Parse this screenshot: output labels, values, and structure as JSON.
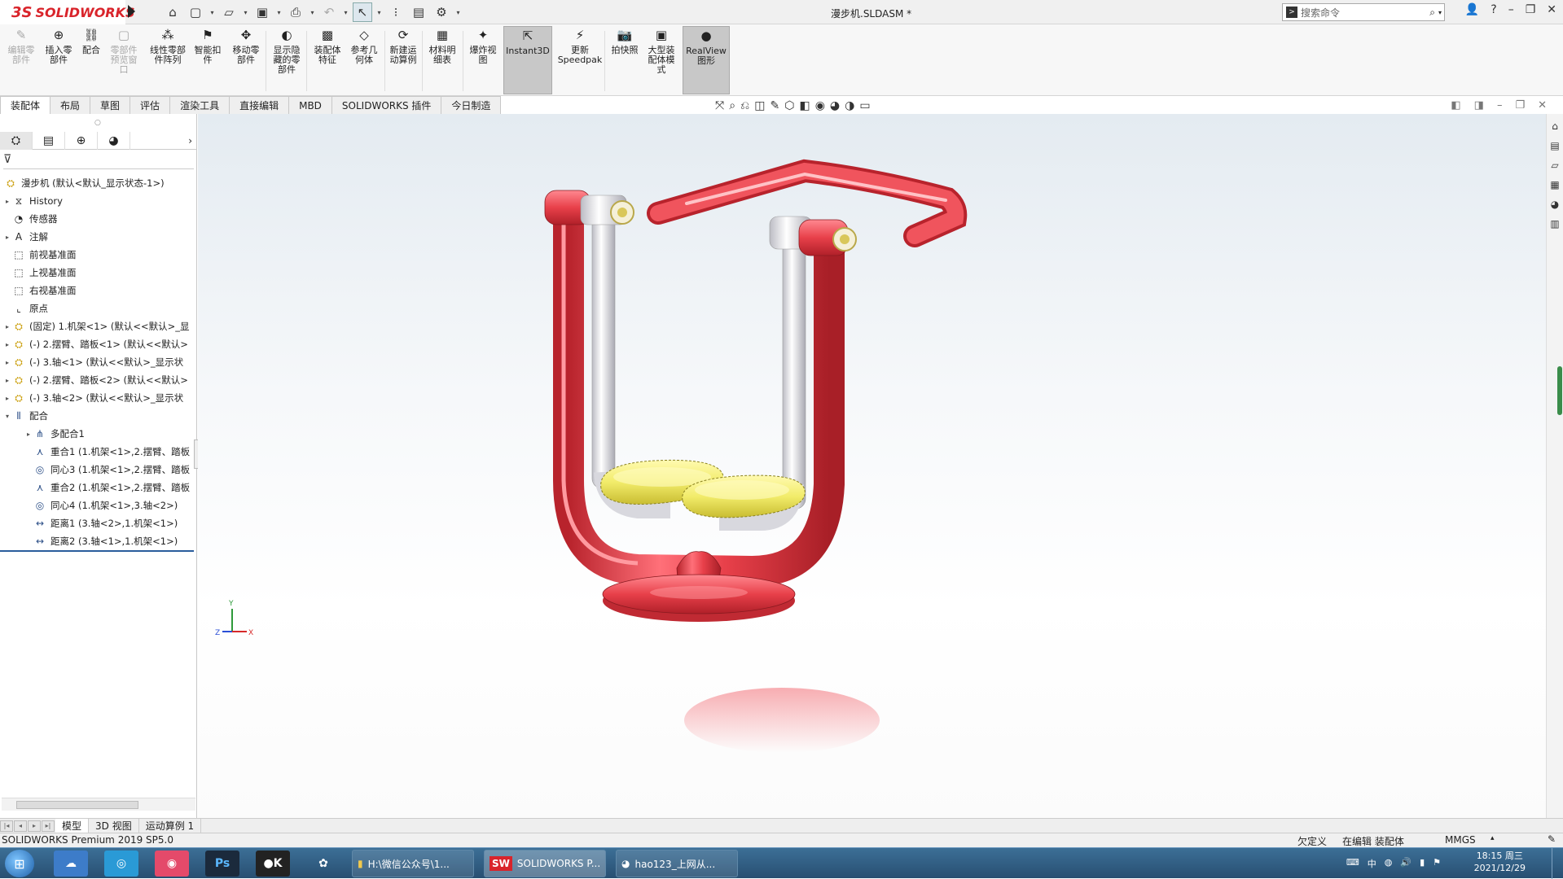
{
  "app": {
    "logo_ds": "3S",
    "logo_text": "SOLIDWORKS",
    "doc_title": "漫步机.SLDASM *",
    "search_placeholder": "搜索命令"
  },
  "ribbon": {
    "buttons": [
      {
        "label": "编辑零\n部件",
        "icon": "edit-component-icon",
        "disabled": true
      },
      {
        "label": "插入零\n部件",
        "icon": "insert-component-icon",
        "disabled": false
      },
      {
        "label": "配合",
        "icon": "mate-icon",
        "disabled": false
      },
      {
        "label": "零部件\n预览窗\n口",
        "icon": "component-preview-icon",
        "disabled": true
      },
      {
        "label": "线性零部\n件阵列",
        "icon": "linear-pattern-icon",
        "disabled": false
      },
      {
        "label": "智能扣\n件",
        "icon": "smart-fastener-icon",
        "disabled": false
      },
      {
        "label": "移动零\n部件",
        "icon": "move-component-icon",
        "disabled": false
      },
      {
        "label": "显示隐\n藏的零\n部件",
        "icon": "show-hidden-icon",
        "disabled": false
      },
      {
        "label": "装配体\n特征",
        "icon": "assembly-feature-icon",
        "disabled": false
      },
      {
        "label": "参考几\n何体",
        "icon": "reference-geometry-icon",
        "disabled": false
      },
      {
        "label": "新建运\n动算例",
        "icon": "new-motion-study-icon",
        "disabled": false
      },
      {
        "label": "材料明\n细表",
        "icon": "bom-icon",
        "disabled": false
      },
      {
        "label": "爆炸视\n图",
        "icon": "exploded-view-icon",
        "disabled": false
      },
      {
        "label": "Instant3D",
        "icon": "instant3d-icon",
        "disabled": false,
        "active": true
      },
      {
        "label": "更新\nSpeedpak",
        "icon": "speedpak-icon",
        "disabled": false
      },
      {
        "label": "拍快照",
        "icon": "snapshot-icon",
        "disabled": false
      },
      {
        "label": "大型装\n配体模\n式",
        "icon": "large-assembly-icon",
        "disabled": false
      },
      {
        "label": "RealView\n图形",
        "icon": "realview-icon",
        "disabled": false,
        "active": true
      }
    ]
  },
  "tabs": [
    "装配体",
    "布局",
    "草图",
    "评估",
    "渲染工具",
    "直接编辑",
    "MBD",
    "SOLIDWORKS 插件",
    "今日制造"
  ],
  "tree": {
    "root": "漫步机 (默认<默认_显示状态-1>)",
    "items": [
      {
        "label": "History",
        "icon": "history-icon",
        "exp": "▸",
        "indent": 0
      },
      {
        "label": "传感器",
        "icon": "sensor-icon",
        "exp": "",
        "indent": 0
      },
      {
        "label": "注解",
        "icon": "annotation-icon",
        "exp": "▸",
        "indent": 0
      },
      {
        "label": "前视基准面",
        "icon": "plane-icon",
        "exp": "",
        "indent": 0
      },
      {
        "label": "上视基准面",
        "icon": "plane-icon",
        "exp": "",
        "indent": 0
      },
      {
        "label": "右视基准面",
        "icon": "plane-icon",
        "exp": "",
        "indent": 0
      },
      {
        "label": "原点",
        "icon": "origin-icon",
        "exp": "",
        "indent": 0
      },
      {
        "label": "(固定) 1.机架<1> (默认<<默认>_显",
        "icon": "part-icon",
        "exp": "▸",
        "indent": 0
      },
      {
        "label": "(-) 2.摆臂、踏板<1> (默认<<默认>",
        "icon": "part-icon",
        "exp": "▸",
        "indent": 0
      },
      {
        "label": "(-) 3.轴<1> (默认<<默认>_显示状",
        "icon": "part-icon",
        "exp": "▸",
        "indent": 0
      },
      {
        "label": "(-) 2.摆臂、踏板<2> (默认<<默认>",
        "icon": "part-icon",
        "exp": "▸",
        "indent": 0
      },
      {
        "label": "(-) 3.轴<2> (默认<<默认>_显示状",
        "icon": "part-icon",
        "exp": "▸",
        "indent": 0
      },
      {
        "label": "配合",
        "icon": "mates-folder-icon",
        "exp": "▾",
        "indent": 0
      },
      {
        "label": "多配合1",
        "icon": "multimate-icon",
        "exp": "▸",
        "indent": 1
      },
      {
        "label": "重合1 (1.机架<1>,2.摆臂、踏板",
        "icon": "coincident-icon",
        "exp": "",
        "indent": 1
      },
      {
        "label": "同心3 (1.机架<1>,2.摆臂、踏板",
        "icon": "concentric-icon",
        "exp": "",
        "indent": 1
      },
      {
        "label": "重合2 (1.机架<1>,2.摆臂、踏板",
        "icon": "coincident-icon",
        "exp": "",
        "indent": 1
      },
      {
        "label": "同心4 (1.机架<1>,3.轴<2>)",
        "icon": "concentric-icon",
        "exp": "",
        "indent": 1
      },
      {
        "label": "距离1 (3.轴<2>,1.机架<1>)",
        "icon": "distance-icon",
        "exp": "",
        "indent": 1
      },
      {
        "label": "距离2 (3.轴<1>,1.机架<1>)",
        "icon": "distance-icon",
        "exp": "",
        "indent": 1
      }
    ]
  },
  "bottom_tabs": [
    "模型",
    "3D 视图",
    "运动算例 1"
  ],
  "status": {
    "product": "SOLIDWORKS Premium 2019 SP5.0",
    "defined": "欠定义",
    "editing": "在编辑 装配体",
    "units": "MMGS"
  },
  "taskbar": {
    "windows": [
      "H:\\微信公众号\\1...",
      "SOLIDWORKS P...",
      "hao123_上网从..."
    ],
    "time": "18:15 周三",
    "date": "2021/12/29"
  },
  "colors": {
    "frame": "#e8404a",
    "arm": "#f4f4f4",
    "pedal": "#f2ec6a",
    "brand": "#d9242b"
  }
}
